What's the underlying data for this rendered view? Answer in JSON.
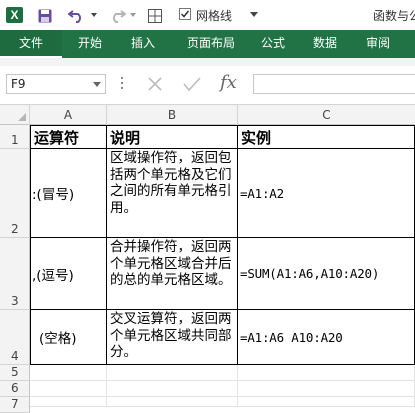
{
  "titlebar": {
    "app_icon_letter": "X",
    "gridlines_label": "网格线",
    "gridlines_checked": true,
    "title_fragment": "函数与公"
  },
  "ribbon": {
    "tabs": [
      "文件",
      "开始",
      "插入",
      "页面布局",
      "公式",
      "数据",
      "审阅"
    ]
  },
  "formula_bar": {
    "name_box": "F9",
    "fx_symbol": "fx",
    "formula": ""
  },
  "sheet": {
    "columns": [
      "A",
      "B",
      "C"
    ],
    "rows": [
      "1",
      "2",
      "3",
      "4",
      "5",
      "6",
      "7"
    ],
    "header": {
      "a": "运算符",
      "b": "说明",
      "c": "实例"
    },
    "data": [
      {
        "a": ":(冒号)",
        "b": "区域操作符，返回包括两个单元格及它们之间的所有单元格引用。",
        "c": "=A1:A2"
      },
      {
        "a": ",(逗号)",
        "b": "合并操作符，返回两个单元格区域合并后的总的单元格区域。",
        "c": "=SUM(A1:A6,A10:A20)"
      },
      {
        "a": "(空格)",
        "b": "交叉运算符，返回两个单元格区域共同部分。",
        "c": "=A1:A6 A10:A20"
      }
    ]
  },
  "colors": {
    "ribbon": "#217346",
    "header_bg": "#f3f3f3"
  }
}
